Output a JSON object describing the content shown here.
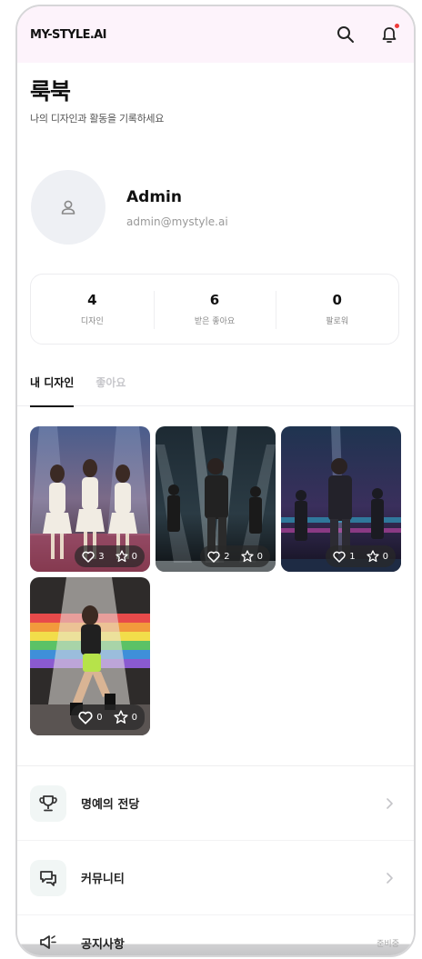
{
  "header": {
    "logo": "MY-STYLE.AI"
  },
  "page": {
    "title": "룩북",
    "subtitle": "나의 디자인과 활동을 기록하세요"
  },
  "profile": {
    "name": "Admin",
    "email": "admin@mystyle.ai"
  },
  "stats": [
    {
      "value": "4",
      "label": "디자인"
    },
    {
      "value": "6",
      "label": "받은 좋아요"
    },
    {
      "value": "0",
      "label": "팔로워"
    }
  ],
  "tabs": [
    {
      "label": "내 디자인",
      "active": true
    },
    {
      "label": "좋아요",
      "active": false
    }
  ],
  "designs": [
    {
      "likes": "3",
      "stars": "0"
    },
    {
      "likes": "2",
      "stars": "0"
    },
    {
      "likes": "1",
      "stars": "0"
    },
    {
      "likes": "0",
      "stars": "0"
    }
  ],
  "menu": [
    {
      "label": "명예의 전당",
      "icon": "trophy-icon"
    },
    {
      "label": "커뮤니티",
      "icon": "chat-icon"
    },
    {
      "label": "공지사항",
      "icon": "megaphone-icon",
      "badge": "준비중"
    }
  ],
  "colors": {
    "header_bg": "#fdf3fb",
    "notification_dot": "#ef3b3b",
    "menu_icon_bg": "#f1f6f5"
  }
}
